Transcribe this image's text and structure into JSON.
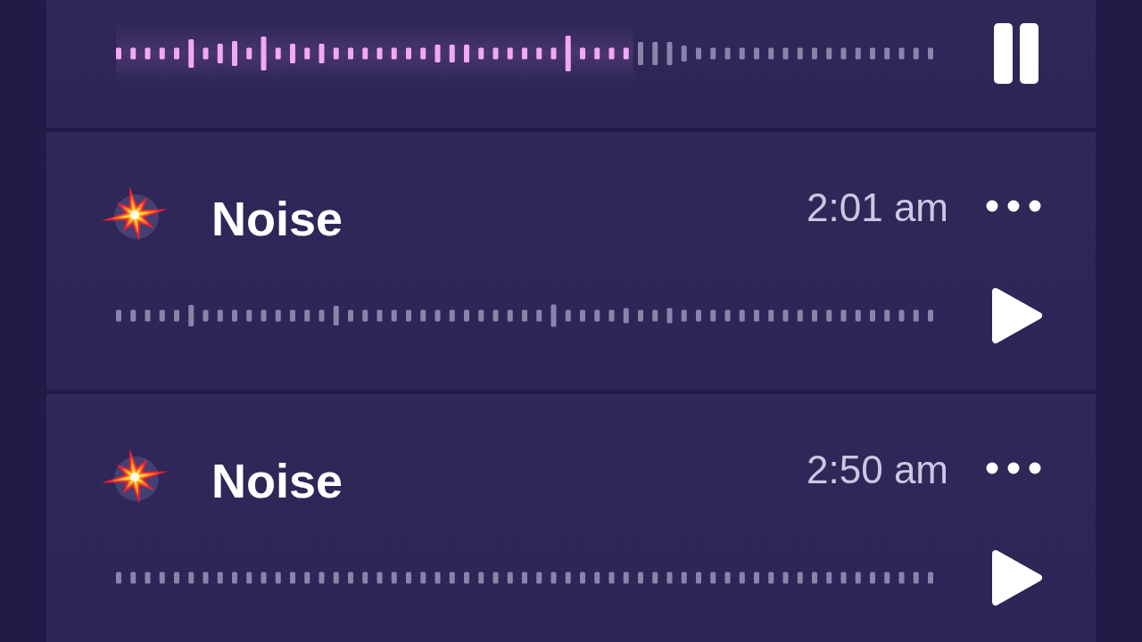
{
  "cards": [
    {
      "playing": true,
      "level": 0.63
    },
    {
      "title": "Noise",
      "time": "2:01 am",
      "playing": false
    },
    {
      "title": "Noise",
      "time": "2:50 am",
      "playing": false
    }
  ]
}
